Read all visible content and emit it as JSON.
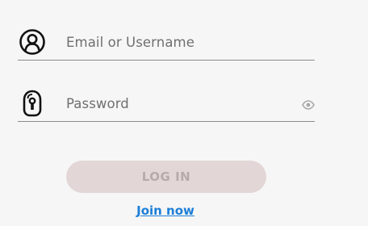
{
  "login_form": {
    "email_field": {
      "icon": "user-circle-icon",
      "placeholder": "Email or Username",
      "value": ""
    },
    "password_field": {
      "icon": "keyhole-lock-icon",
      "placeholder": "Password",
      "value": "",
      "toggle_icon": "eye-icon"
    },
    "login_button_label": "LOG IN",
    "join_link_label": "Join now"
  },
  "colors": {
    "background": "#f6f6f6",
    "text_muted": "#6f6f6f",
    "underline": "#8c8c8c",
    "button_disabled_bg": "#e2d6d6",
    "button_disabled_text": "#b8aaaa",
    "link": "#1c7ed6"
  }
}
